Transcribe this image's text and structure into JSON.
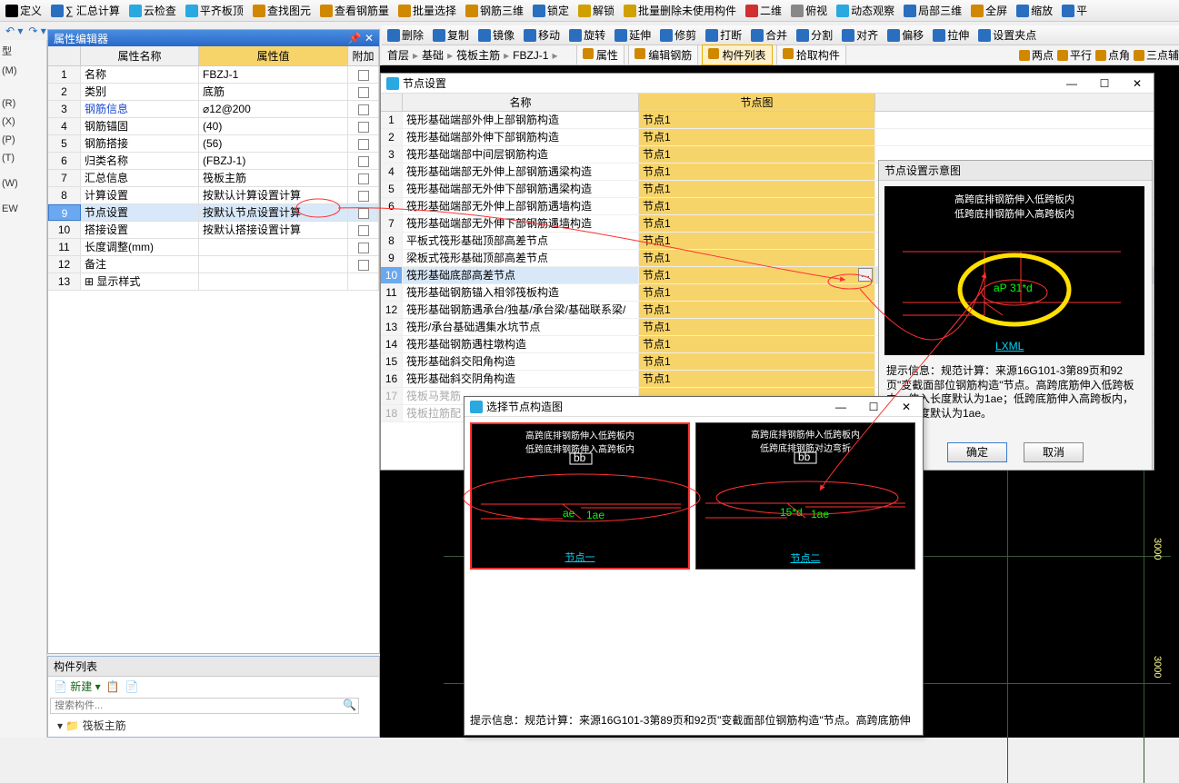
{
  "top_toolbar": [
    "定义",
    "∑ 汇总计算",
    "云检查",
    "平齐板顶",
    "查找图元",
    "查看钢筋量",
    "批量选择",
    "钢筋三维",
    "锁定",
    "解锁",
    "批量删除未使用构件",
    "二维",
    "俯视",
    "动态观察",
    "局部三维",
    "全屏",
    "缩放",
    "平"
  ],
  "edit_toolbar": [
    "删除",
    "复制",
    "镜像",
    "移动",
    "旋转",
    "延伸",
    "修剪",
    "打断",
    "合并",
    "分割",
    "对齐",
    "偏移",
    "拉伸",
    "设置夹点"
  ],
  "breadcrumb": {
    "items": [
      "首层",
      "基础",
      "筏板主筋",
      "FBZJ-1"
    ],
    "tabs": [
      "属性",
      "编辑钢筋",
      "构件列表",
      "拾取构件"
    ],
    "active_tab": 2,
    "right_items": [
      "两点",
      "平行",
      "点角",
      "三点辅"
    ]
  },
  "prop_panel": {
    "title": "属性编辑器",
    "headers": [
      "",
      "属性名称",
      "属性值",
      "附加"
    ],
    "rows": [
      {
        "idx": "1",
        "name": "名称",
        "value": "FBZJ-1",
        "chk": false
      },
      {
        "idx": "2",
        "name": "类别",
        "value": "底筋",
        "chk": true
      },
      {
        "idx": "3",
        "name": "钢筋信息",
        "value": "⌀12@200",
        "chk": true,
        "link": true
      },
      {
        "idx": "4",
        "name": "钢筋锚固",
        "value": "(40)",
        "chk": false
      },
      {
        "idx": "5",
        "name": "钢筋搭接",
        "value": "(56)",
        "chk": false
      },
      {
        "idx": "6",
        "name": "归类名称",
        "value": "(FBZJ-1)",
        "chk": true
      },
      {
        "idx": "7",
        "name": "汇总信息",
        "value": "筏板主筋",
        "chk": true
      },
      {
        "idx": "8",
        "name": "计算设置",
        "value": "按默认计算设置计算",
        "chk": false
      },
      {
        "idx": "9",
        "name": "节点设置",
        "value": "按默认节点设置计算",
        "chk": false,
        "sel": true
      },
      {
        "idx": "10",
        "name": "搭接设置",
        "value": "按默认搭接设置计算",
        "chk": false
      },
      {
        "idx": "11",
        "name": "长度调整(mm)",
        "value": "",
        "chk": true
      },
      {
        "idx": "12",
        "name": "备注",
        "value": "",
        "chk": true
      },
      {
        "idx": "13",
        "name": "显示样式",
        "value": "",
        "expand": true
      }
    ]
  },
  "comp_list": {
    "title": "构件列表",
    "new_btn": "新建",
    "search_ph": "搜索构件...",
    "tree_root": "筏板主筋"
  },
  "node_dialog": {
    "title": "节点设置",
    "headers": [
      "",
      "名称",
      "节点图"
    ],
    "rows": [
      {
        "idx": 1,
        "name": "筏形基础端部外伸上部钢筋构造",
        "pic": "节点1"
      },
      {
        "idx": 2,
        "name": "筏形基础端部外伸下部钢筋构造",
        "pic": "节点1"
      },
      {
        "idx": 3,
        "name": "筏形基础端部中间层钢筋构造",
        "pic": "节点1"
      },
      {
        "idx": 4,
        "name": "筏形基础端部无外伸上部钢筋遇梁构造",
        "pic": "节点1"
      },
      {
        "idx": 5,
        "name": "筏形基础端部无外伸下部钢筋遇梁构造",
        "pic": "节点1"
      },
      {
        "idx": 6,
        "name": "筏形基础端部无外伸上部钢筋遇墙构造",
        "pic": "节点1"
      },
      {
        "idx": 7,
        "name": "筏形基础端部无外伸下部钢筋遇墙构造",
        "pic": "节点1"
      },
      {
        "idx": 8,
        "name": "平板式筏形基础顶部高差节点",
        "pic": "节点1"
      },
      {
        "idx": 9,
        "name": "梁板式筏形基础顶部高差节点",
        "pic": "节点1"
      },
      {
        "idx": 10,
        "name": "筏形基础底部高差节点",
        "pic": "节点1",
        "sel": true,
        "editing": true
      },
      {
        "idx": 11,
        "name": "筏形基础钢筋锚入相邻筏板构造",
        "pic": "节点1"
      },
      {
        "idx": 12,
        "name": "筏形基础钢筋遇承台/独基/承台梁/基础联系梁/",
        "pic": "节点1"
      },
      {
        "idx": 13,
        "name": "筏形/承台基础遇集水坑节点",
        "pic": "节点1"
      },
      {
        "idx": 14,
        "name": "筏形基础钢筋遇柱墩构造",
        "pic": "节点1"
      },
      {
        "idx": 15,
        "name": "筏形基础斜交阳角构造",
        "pic": "节点1"
      },
      {
        "idx": 16,
        "name": "筏形基础斜交阴角构造",
        "pic": "节点1"
      },
      {
        "idx": 17,
        "name": "筏板马凳筋",
        "pic": "",
        "dis": true
      },
      {
        "idx": 18,
        "name": "筏板拉筋配",
        "pic": "",
        "dis": true
      }
    ]
  },
  "preview": {
    "header": "节点设置示意图",
    "line1": "高跨底排钢筋伸入低跨板内",
    "line2": "低跨底排钢筋伸入高跨板内",
    "dim": "31*d",
    "hint_label": "提示信息：",
    "hint": "规范计算：来源16G101-3第89页和92页\"变截面部位钢筋构造\"节点。高跨底筋伸入低跨板内，伸入长度默认为1ae；低跨底筋伸入高跨板内，伸入长度默认为1ae。",
    "ok": "确定",
    "cancel": "取消"
  },
  "choose": {
    "title": "选择节点构造图",
    "opt1": {
      "line1": "高跨底排钢筋伸入低跨板内",
      "line2": "低跨底排钢筋伸入高跨板内",
      "dim1": "ae",
      "dim2": "1ae",
      "bb": "bb",
      "cap": "节点一"
    },
    "opt2": {
      "line1": "高跨底排钢筋伸入低跨板内",
      "line2": "低跨底排钢筋对边弯折",
      "dim1": "15*d",
      "dim2": "1ae",
      "bb": "bb",
      "cap": "节点二"
    },
    "hint_label": "提示信息：",
    "hint": "规范计算：来源16G101-3第89页和92页\"变截面部位钢筋构造\"节点。高跨底筋伸"
  },
  "viewport_dims": [
    "3000",
    "3000"
  ],
  "left_strip": [
    "型",
    "(M)",
    "",
    "",
    "(R)",
    "(X)",
    "(P)",
    "(T)",
    "",
    "(W)",
    "",
    "EW"
  ]
}
